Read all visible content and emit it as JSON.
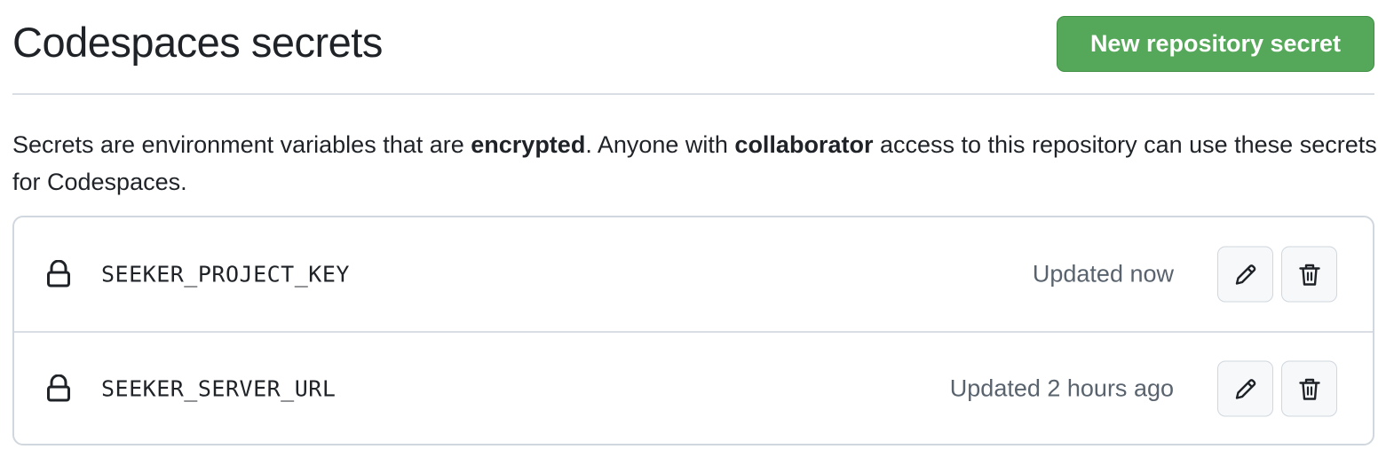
{
  "header": {
    "title": "Codespaces secrets",
    "new_secret_label": "New repository secret"
  },
  "description": {
    "part1": "Secrets are environment variables that are ",
    "bold1": "encrypted",
    "part2": ". Anyone with ",
    "bold2": "collaborator",
    "part3": " access to this repository can use these secrets for Codespaces."
  },
  "secrets": [
    {
      "name": "SEEKER_PROJECT_KEY",
      "updated": "Updated now",
      "icon": "lock-icon"
    },
    {
      "name": "SEEKER_SERVER_URL",
      "updated": "Updated 2 hours ago",
      "icon": "lock-icon"
    }
  ],
  "actions": {
    "edit_icon": "pencil-icon",
    "delete_icon": "trash-icon"
  },
  "colors": {
    "primary_button": "#55a85a",
    "text": "#1f2328",
    "muted_text": "#59636e",
    "border": "#d0d7de"
  }
}
